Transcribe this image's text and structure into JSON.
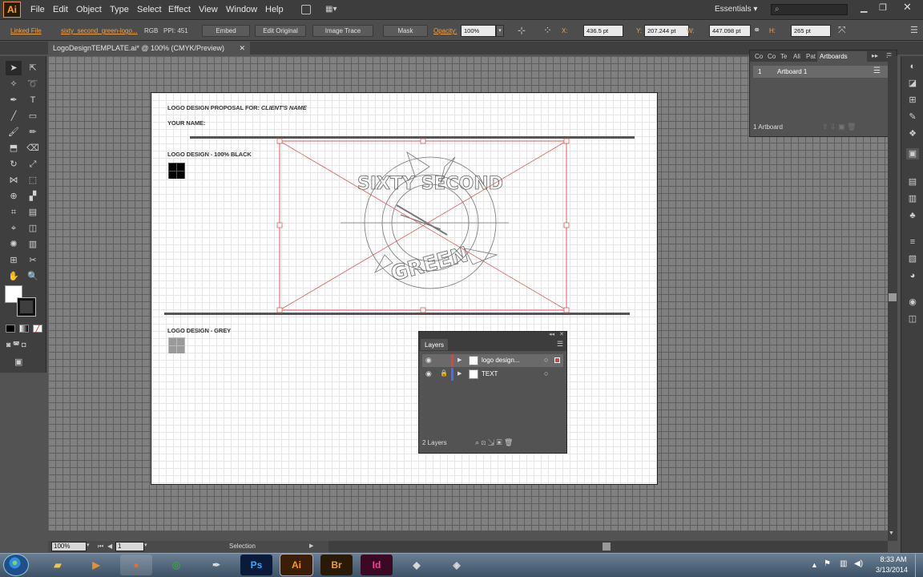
{
  "app": {
    "logo_text": "Ai",
    "workspace": "Essentials"
  },
  "menu": [
    "File",
    "Edit",
    "Object",
    "Type",
    "Select",
    "Effect",
    "View",
    "Window",
    "Help"
  ],
  "control_bar": {
    "linked_file": "Linked File",
    "filename": "sixty_second_green-logo...",
    "color_mode": "RGB",
    "ppi": "PPI: 451",
    "embed": "Embed",
    "edit_original": "Edit Original",
    "image_trace": "Image Trace",
    "mask": "Mask",
    "opacity_label": "Opacity:",
    "opacity_value": "100%",
    "x_label": "X:",
    "x_value": "436.5 pt",
    "y_label": "Y:",
    "y_value": "207.244 pt",
    "w_label": "W:",
    "w_value": "447.098 pt",
    "h_label": "H:",
    "h_value": "265 pt"
  },
  "document_tab": {
    "title": "LogoDesignTEMPLATE.ai* @ 100% (CMYK/Preview)"
  },
  "artboard": {
    "proposal_label": "LOGO DESIGN PROPOSAL FOR:",
    "client_name": "CLIENT'S NAME",
    "your_name": "YOUR NAME:",
    "black_label": "LOGO DESIGN - 100% BLACK",
    "grey_label": "LOGO DESIGN - GREY",
    "logo_top_text": "SIXTY SECOND",
    "logo_bottom_text": "GREEN"
  },
  "artboards_panel": {
    "tabs": [
      "Co",
      "Co",
      "Te",
      "Ali",
      "Pat",
      "Artboards"
    ],
    "active_tab": "Artboards",
    "rows": [
      {
        "index": "1",
        "name": "Artboard 1"
      }
    ],
    "footer": "1 Artboard"
  },
  "layers_panel": {
    "title": "Layers",
    "layers": [
      {
        "name": "logo design...",
        "color": "#e0433f"
      },
      {
        "name": "TEXT",
        "color": "#4a6cf0"
      }
    ],
    "footer": "2 Layers"
  },
  "status_bar": {
    "zoom": "100%",
    "artboard_num": "1",
    "tool": "Selection"
  },
  "taskbar": {
    "time": "8:33 AM",
    "date": "3/13/2014",
    "apps": [
      "Ps",
      "Ai",
      "Br",
      "Id"
    ]
  }
}
